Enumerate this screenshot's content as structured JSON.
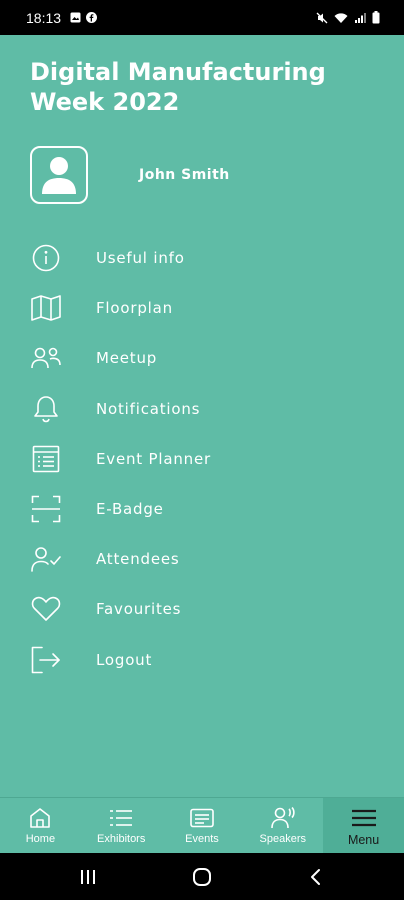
{
  "status_bar": {
    "time": "18:13"
  },
  "app": {
    "title": "Digital Manufacturing Week 2022"
  },
  "profile": {
    "name": "John Smith"
  },
  "menu": {
    "items": [
      {
        "label": "Useful info",
        "icon": "info-icon"
      },
      {
        "label": "Floorplan",
        "icon": "map-icon"
      },
      {
        "label": "Meetup",
        "icon": "users-icon"
      },
      {
        "label": "Notifications",
        "icon": "bell-icon"
      },
      {
        "label": "Event Planner",
        "icon": "planner-icon"
      },
      {
        "label": "E-Badge",
        "icon": "scan-icon"
      },
      {
        "label": "Attendees",
        "icon": "user-check-icon"
      },
      {
        "label": "Favourites",
        "icon": "heart-icon"
      },
      {
        "label": "Logout",
        "icon": "logout-icon"
      }
    ]
  },
  "bottom_nav": {
    "active": "Menu",
    "items": [
      {
        "label": "Home",
        "icon": "home-icon"
      },
      {
        "label": "Exhibitors",
        "icon": "list-icon"
      },
      {
        "label": "Events",
        "icon": "events-icon"
      },
      {
        "label": "Speakers",
        "icon": "speaker-icon"
      },
      {
        "label": "Menu",
        "icon": "hamburger-icon"
      }
    ]
  },
  "colors": {
    "background": "#5fbca6",
    "text": "#ffffff",
    "active_nav_label": "#1a1a1a"
  }
}
